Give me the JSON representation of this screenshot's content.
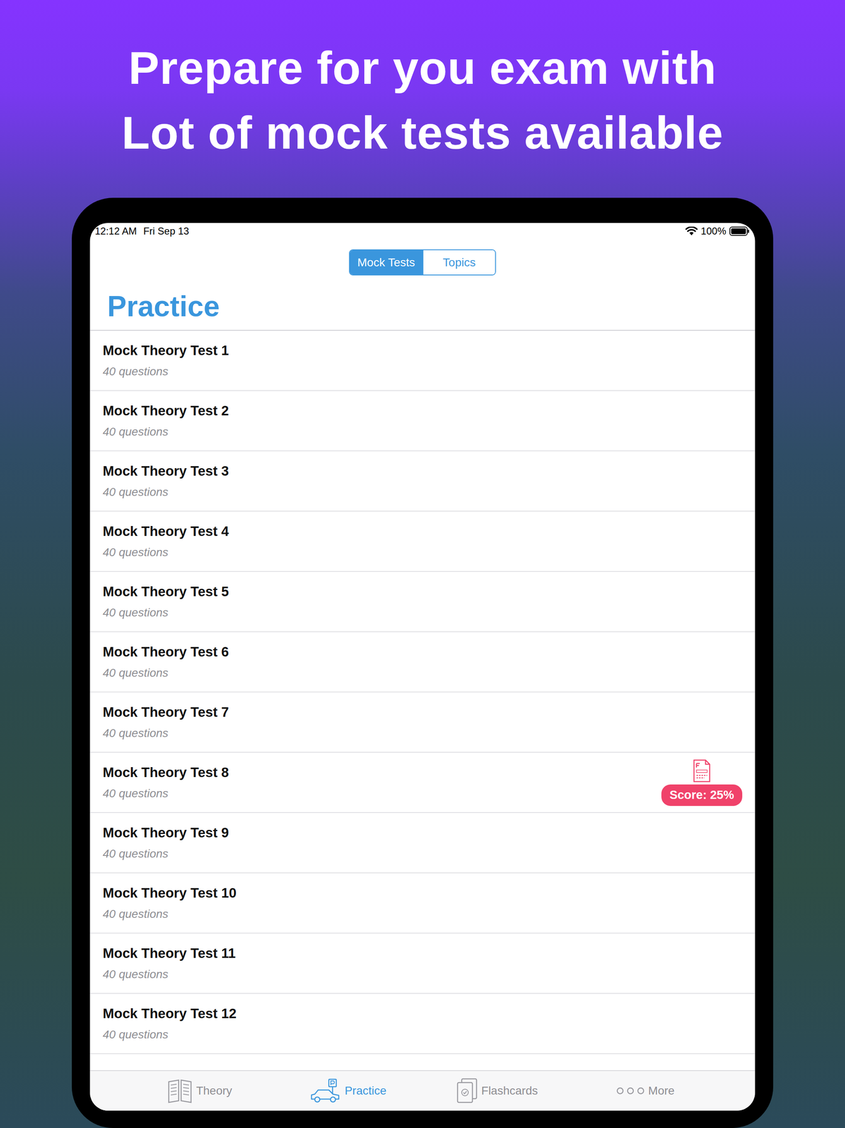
{
  "headline": [
    "Prepare for you exam with",
    "Lot of mock tests available"
  ],
  "status_bar": {
    "time": "12:12 AM",
    "date": "Fri Sep 13",
    "battery": "100%"
  },
  "segments": [
    {
      "label": "Mock Tests",
      "selected": true
    },
    {
      "label": "Topics",
      "selected": false
    }
  ],
  "title": "Practice",
  "tests": [
    {
      "title": "Mock Theory Test 1",
      "subtitle": "40 questions"
    },
    {
      "title": "Mock Theory Test 2",
      "subtitle": "40 questions"
    },
    {
      "title": "Mock Theory Test 3",
      "subtitle": "40 questions"
    },
    {
      "title": "Mock Theory Test 4",
      "subtitle": "40 questions"
    },
    {
      "title": "Mock Theory Test 5",
      "subtitle": "40 questions"
    },
    {
      "title": "Mock Theory Test 6",
      "subtitle": "40 questions"
    },
    {
      "title": "Mock Theory Test 7",
      "subtitle": "40 questions"
    },
    {
      "title": "Mock Theory Test 8",
      "subtitle": "40 questions",
      "score": "Score: 25%",
      "failed": true
    },
    {
      "title": "Mock Theory Test 9",
      "subtitle": "40 questions"
    },
    {
      "title": "Mock Theory Test 10",
      "subtitle": "40 questions"
    },
    {
      "title": "Mock Theory Test 11",
      "subtitle": "40 questions"
    },
    {
      "title": "Mock Theory Test 12",
      "subtitle": "40 questions"
    }
  ],
  "tab_bar": [
    {
      "label": "Theory",
      "selected": false
    },
    {
      "label": "Practice",
      "selected": true
    },
    {
      "label": "Flashcards",
      "selected": false
    },
    {
      "label": "More",
      "selected": false
    }
  ]
}
